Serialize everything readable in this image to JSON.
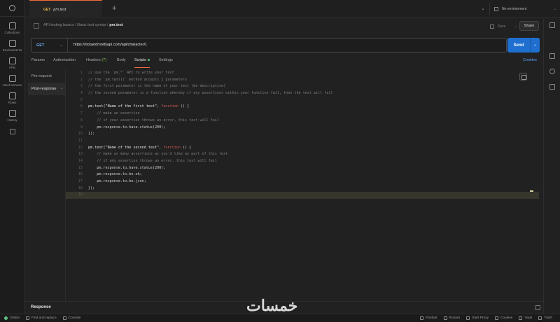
{
  "colors": {
    "accent": "#f26b3a",
    "send": "#1f6fd0",
    "method_get": "#70b0ff",
    "link": "#5aa2ff",
    "keyword": "#d75a5a"
  },
  "left_rail": {
    "items": [
      {
        "label": "Collections",
        "icon": "collections-icon"
      },
      {
        "label": "Environments",
        "icon": "environments-icon"
      },
      {
        "label": "APIs",
        "icon": "apis-icon"
      },
      {
        "label": "Mock servers",
        "icon": "mock-servers-icon"
      },
      {
        "label": "Flows",
        "icon": "flows-icon"
      },
      {
        "label": "History",
        "icon": "history-icon"
      }
    ]
  },
  "tab": {
    "method": "GET",
    "name": "pm.test"
  },
  "environment": {
    "label": "No environment"
  },
  "breadcrumb": {
    "collection": "API testing basics",
    "folder": "Basic test syntax",
    "current": "pm.test",
    "sep": "/"
  },
  "toolbar": {
    "save_label": "Save",
    "share_label": "Share"
  },
  "request": {
    "method": "GET",
    "url": "https://rickandmortyapi.com/api/character/1",
    "send_label": "Send"
  },
  "request_tabs": {
    "params": "Params",
    "authorization": "Authorization",
    "headers": "Headers",
    "headers_count": "(7)",
    "body": "Body",
    "scripts": "Scripts",
    "settings": "Settings",
    "cookies": "Cookies"
  },
  "scripts_side": {
    "pre_request": "Pre-request",
    "post_response": "Post-response"
  },
  "code": [
    {
      "n": "1",
      "parts": [
        [
          "c-comment",
          "// use the `pm.*` API to write your test"
        ]
      ]
    },
    {
      "n": "2",
      "parts": [
        [
          "c-comment",
          "// the `pm.test()` method accepts 2 parameters"
        ]
      ]
    },
    {
      "n": "3",
      "parts": [
        [
          "c-comment",
          "// the first parameter is the name of your test (be descriptive)"
        ]
      ]
    },
    {
      "n": "4",
      "parts": [
        [
          "c-comment",
          "// the second parameter is a function whereby if any assertions within your function fail, then the test will fail"
        ]
      ]
    },
    {
      "n": "5",
      "parts": []
    },
    {
      "n": "6",
      "parts": [
        [
          "c-fn",
          "pm.test("
        ],
        [
          "c-str",
          "\"Name of the first test\""
        ],
        [
          "c-plain",
          ", "
        ],
        [
          "c-kw",
          "function"
        ],
        [
          "c-plain",
          " () {"
        ]
      ]
    },
    {
      "n": "7",
      "parts": [
        [
          "c-comment",
          "    // make an assertion"
        ]
      ]
    },
    {
      "n": "8",
      "parts": [
        [
          "c-comment",
          "    // if your assertion throws an error, this test will fail"
        ]
      ]
    },
    {
      "n": "9",
      "parts": [
        [
          "c-plain",
          "    pm.response.to.have.status(200);"
        ]
      ]
    },
    {
      "n": "10",
      "parts": [
        [
          "c-plain",
          "});"
        ]
      ]
    },
    {
      "n": "11",
      "parts": []
    },
    {
      "n": "12",
      "parts": [
        [
          "c-fn",
          "pm.test("
        ],
        [
          "c-str",
          "\"Name of the second test\""
        ],
        [
          "c-plain",
          ", "
        ],
        [
          "c-kw",
          "function"
        ],
        [
          "c-plain",
          " () {"
        ]
      ]
    },
    {
      "n": "13",
      "parts": [
        [
          "c-comment",
          "    // make as many assertions as you'd like as part of this test"
        ]
      ]
    },
    {
      "n": "14",
      "parts": [
        [
          "c-comment",
          "    // if any assertion throws an error, this test will fail"
        ]
      ]
    },
    {
      "n": "15",
      "parts": [
        [
          "c-plain",
          "    pm.response.to.have.status(200);"
        ]
      ]
    },
    {
      "n": "16",
      "parts": [
        [
          "c-plain",
          "    pm.response.to.be.ok;"
        ]
      ]
    },
    {
      "n": "17",
      "parts": [
        [
          "c-plain",
          "    pm.response.to.be.json;"
        ]
      ]
    },
    {
      "n": "18",
      "parts": [
        [
          "c-plain",
          "});"
        ]
      ]
    },
    {
      "n": "19",
      "parts": [],
      "cursor": true
    }
  ],
  "response": {
    "label": "Response"
  },
  "status_bar": {
    "left": [
      {
        "label": "Online",
        "icon": "online-status-icon"
      },
      {
        "label": "Find and replace",
        "icon": "find-replace-icon"
      },
      {
        "label": "Console",
        "icon": "console-icon"
      }
    ],
    "right": [
      {
        "label": "Postbot",
        "icon": "postbot-icon"
      },
      {
        "label": "Runner",
        "icon": "runner-icon"
      },
      {
        "label": "Start Proxy",
        "icon": "proxy-icon"
      },
      {
        "label": "Cookies",
        "icon": "cookies-icon"
      },
      {
        "label": "Vault",
        "icon": "vault-icon"
      },
      {
        "label": "Trash",
        "icon": "trash-icon"
      }
    ]
  },
  "watermark": {
    "text": "خمسات"
  }
}
